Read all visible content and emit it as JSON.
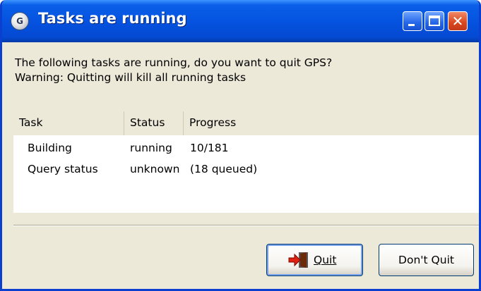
{
  "window": {
    "title": "Tasks are running",
    "app_icon_letter": "G",
    "close_glyph": "✕"
  },
  "message": {
    "line1": "The following tasks are running, do you want to quit GPS?",
    "line2": "Warning: Quitting will kill all running tasks"
  },
  "table": {
    "columns": [
      "Task",
      "Status",
      "Progress"
    ],
    "rows": [
      {
        "task": "Building",
        "status": "running",
        "progress": "10/181"
      },
      {
        "task": "Query status",
        "status": "unknown",
        "progress": "(18 queued)"
      }
    ]
  },
  "buttons": {
    "quit_label": "Quit",
    "dont_quit_label": "Don't Quit"
  },
  "icons": {
    "app": "gps-logo-icon",
    "quit": "exit-door-icon"
  },
  "colors": {
    "titlebar": "#0553e0",
    "close_button": "#d9461c",
    "dialog_face": "#ece9d8"
  }
}
